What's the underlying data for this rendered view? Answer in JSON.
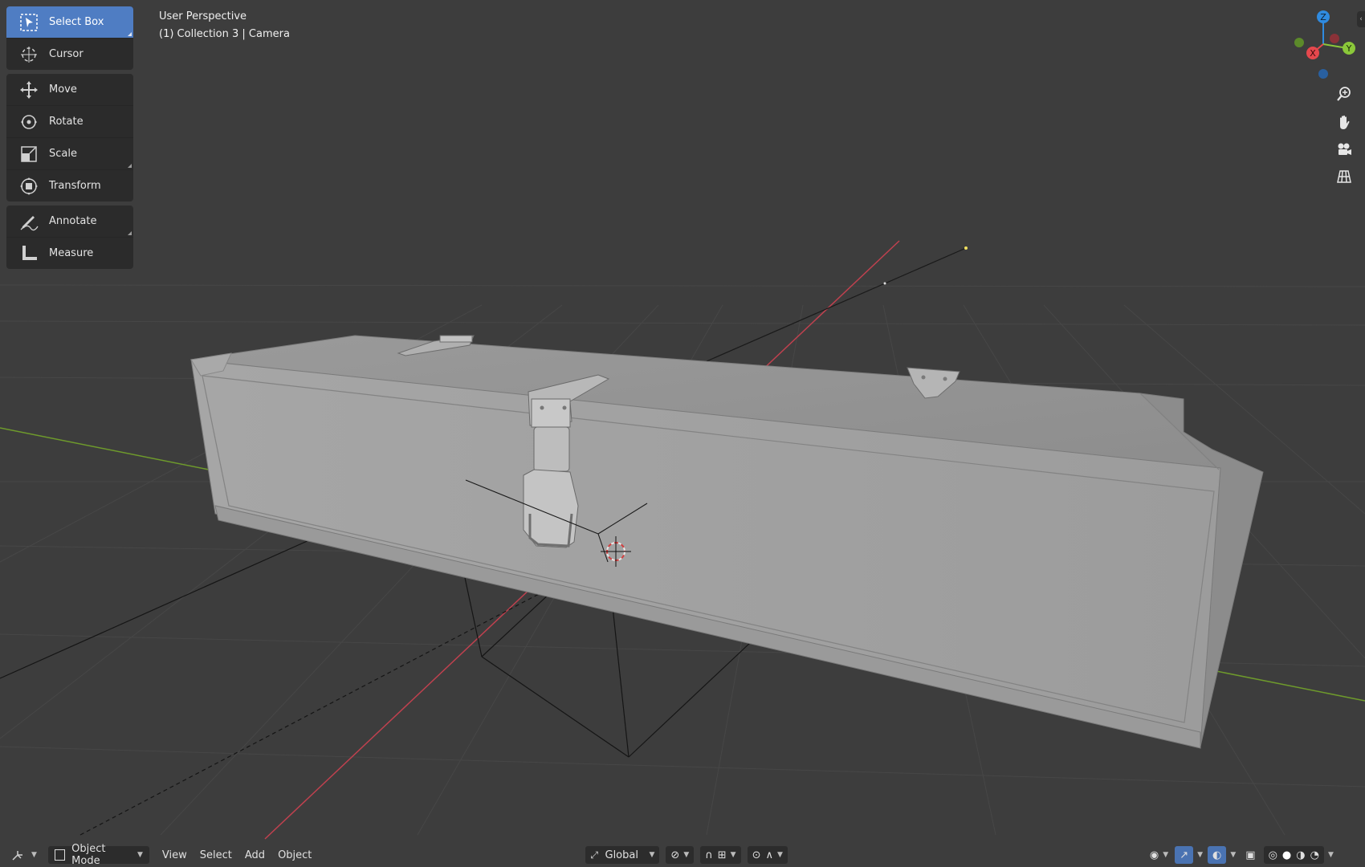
{
  "toolbar": {
    "tools": [
      {
        "label": "Select Box",
        "icon": "select-box-icon",
        "active": true
      },
      {
        "label": "Cursor",
        "icon": "cursor-icon"
      },
      {
        "label": "Move",
        "icon": "move-icon"
      },
      {
        "label": "Rotate",
        "icon": "rotate-icon"
      },
      {
        "label": "Scale",
        "icon": "scale-icon"
      },
      {
        "label": "Transform",
        "icon": "transform-icon"
      },
      {
        "label": "Annotate",
        "icon": "annotate-icon"
      },
      {
        "label": "Measure",
        "icon": "measure-icon"
      }
    ]
  },
  "viewport": {
    "perspective_label": "User Perspective",
    "collection_label": "(1) Collection 3 | Camera"
  },
  "gizmo": {
    "axis_z": "Z",
    "axis_y": "Y",
    "axis_x": "X",
    "colors": {
      "x": "#e5484d",
      "y": "#8bc83a",
      "z": "#2f8be0"
    }
  },
  "nav_buttons": [
    "zoom-icon",
    "hand-pan-icon",
    "camera-view-icon",
    "grid-ortho-icon"
  ],
  "bottom_bar": {
    "mode": "Object Mode",
    "menus": [
      "View",
      "Select",
      "Add",
      "Object"
    ],
    "orientation": "Global"
  },
  "colors": {
    "background": "#3d3d3d",
    "accent": "#4f7dc3",
    "toolbar_bg": "#2b2b2b"
  }
}
